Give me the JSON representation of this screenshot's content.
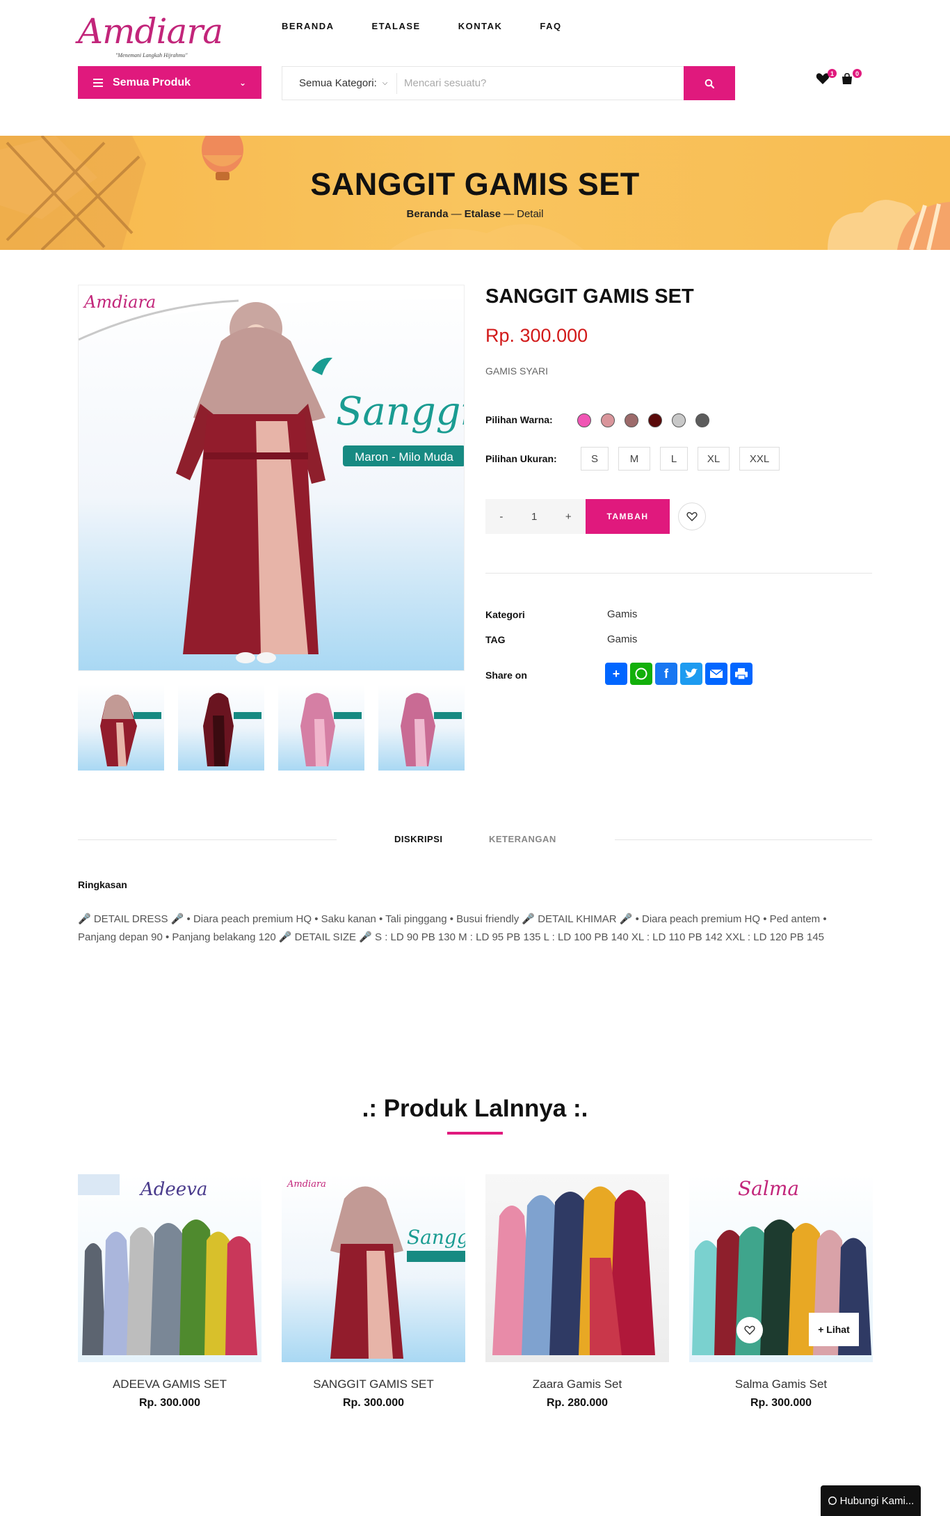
{
  "brand": {
    "name": "Amdiara",
    "tagline": "\"Menemani Langkah Hijrahmu\""
  },
  "nav": [
    "BERANDA",
    "ETALASE",
    "KONTAK",
    "FAQ"
  ],
  "all_products_label": "Semua Produk",
  "search": {
    "category": "Semua Kategori:",
    "placeholder": "Mencari sesuatu?"
  },
  "header_counts": {
    "wishlist": "1",
    "cart": "0"
  },
  "banner": {
    "title": "SANGGIT GAMIS SET",
    "crumbs": [
      "Beranda",
      "Etalase",
      "Detail"
    ]
  },
  "product": {
    "title": "SANGGIT GAMIS SET",
    "price": "Rp. 300.000",
    "category_tag": "GAMIS SYARI",
    "color_label": "Pilihan Warna:",
    "colors": [
      "#f055b4",
      "#d9959b",
      "#9c6a6a",
      "#5a0a0a",
      "#c8c8c8",
      "#5c5c5c"
    ],
    "size_label": "Pilihan Ukuran:",
    "sizes": [
      "S",
      "M",
      "L",
      "XL",
      "XXL"
    ],
    "qty": "1",
    "qty_minus": "-",
    "qty_plus": "+",
    "add_label": "TAMBAH",
    "meta": {
      "kategori_label": "Kategori",
      "kategori_value": "Gamis",
      "tag_label": "TAG",
      "tag_value": "Gamis",
      "share_label": "Share on"
    },
    "image_text": {
      "script": "Sanggit",
      "variant": "Maron - Milo Muda",
      "logo": "Amdiara"
    }
  },
  "share_icons": [
    "addtoany-icon",
    "whatsapp-icon",
    "facebook-icon",
    "twitter-icon",
    "email-icon",
    "print-icon"
  ],
  "tabs": [
    "DISKRIPSI",
    "KETERANGAN"
  ],
  "summary_heading": "Ringkasan",
  "description": "🎤 DETAIL DRESS 🎤 • Diara peach premium HQ • Saku kanan • Tali pinggang • Busui friendly 🎤 DETAIL KHIMAR 🎤 • Diara peach premium HQ • Ped antem • Panjang depan 90 • Panjang belakang 120 🎤 DETAIL SIZE 🎤 S : LD 90 PB 130 M : LD 95 PB 135 L : LD 100 PB 140 XL : LD 110 PB 142 XXL : LD 120 PB 145",
  "related_title": ".: Produk LaInnya :.",
  "related": [
    {
      "name": "ADEEVA GAMIS SET",
      "price": "Rp. 300.000"
    },
    {
      "name": "SANGGIT GAMIS SET",
      "price": "Rp. 300.000"
    },
    {
      "name": "Zaara Gamis Set",
      "price": "Rp. 280.000"
    },
    {
      "name": "Salma Gamis Set",
      "price": "Rp. 300.000"
    }
  ],
  "lihat_label": "+ Lihat",
  "whatsapp_label": "Hubungi Kami..."
}
